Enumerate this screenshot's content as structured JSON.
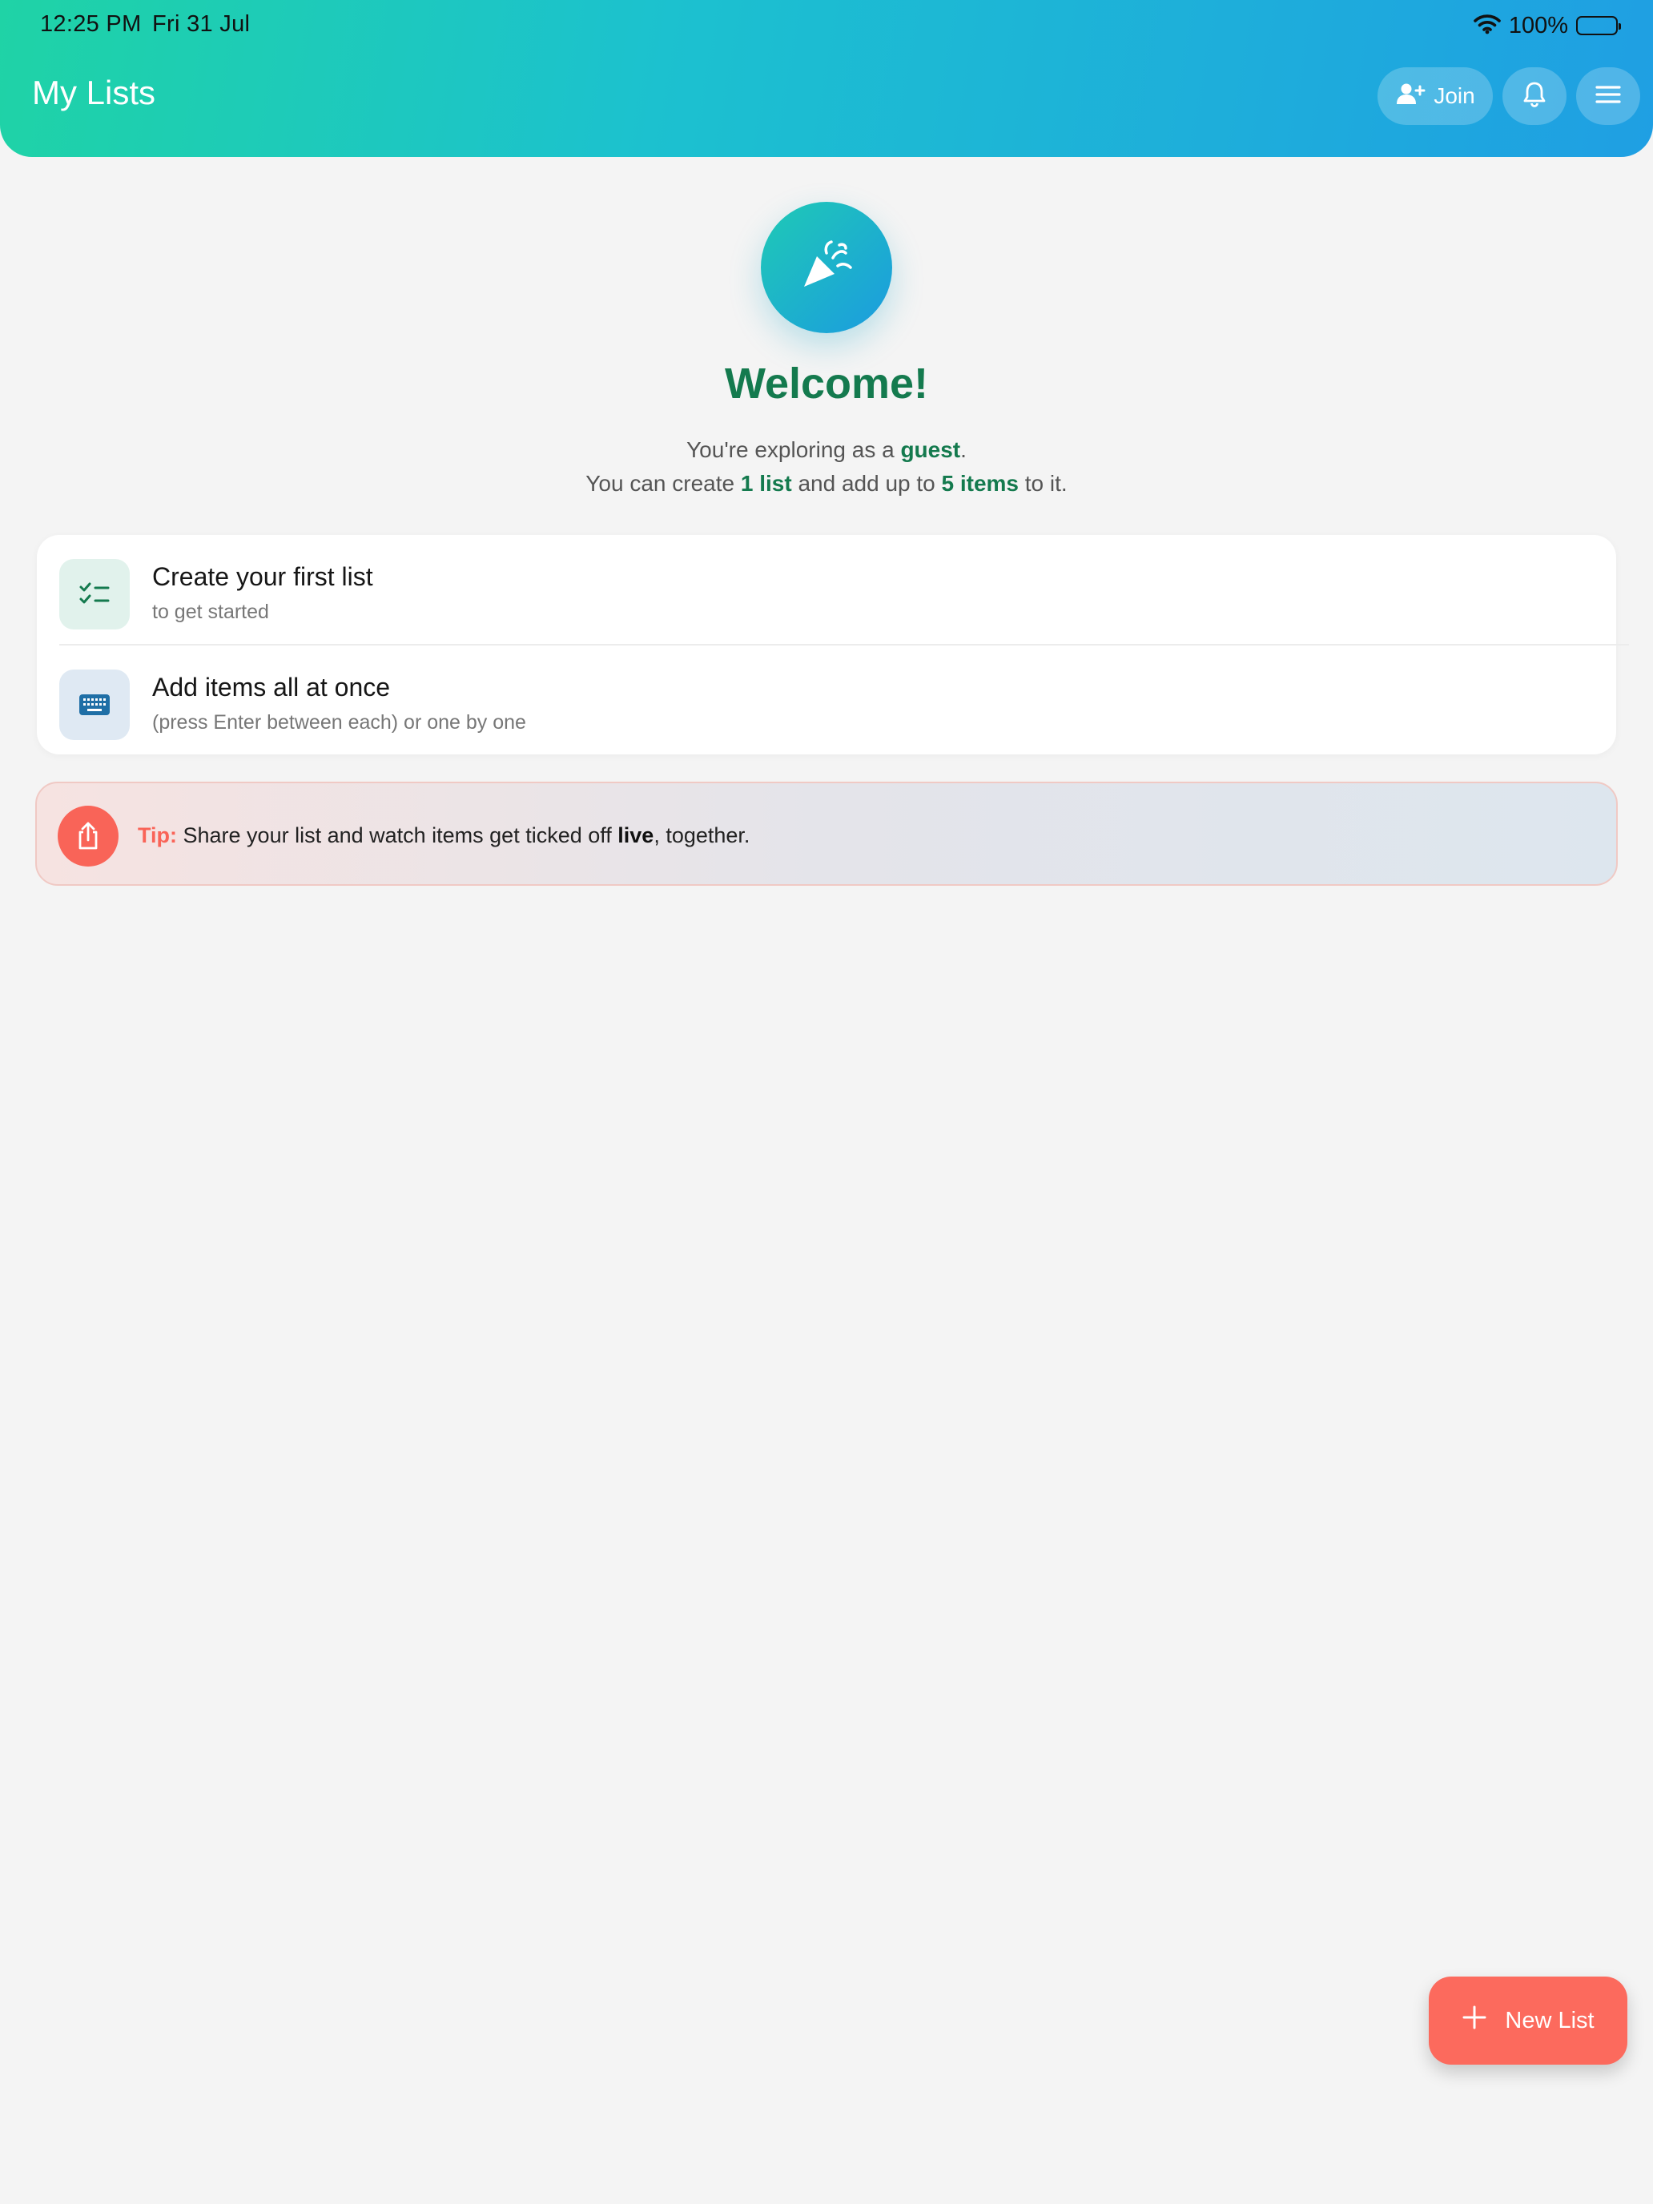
{
  "status_bar": {
    "time": "12:25 PM",
    "date": "Fri 31 Jul",
    "battery": "100%",
    "icons": [
      "wifi-icon",
      "battery-icon"
    ]
  },
  "header": {
    "title": "My Lists",
    "join_label": "Join",
    "buttons": [
      "add-user-icon",
      "bell-icon",
      "menu-icon"
    ]
  },
  "welcome": {
    "title": "Welcome!",
    "line1_prefix": "You're exploring as a ",
    "line1_bold": "guest",
    "line1_suffix": ".",
    "line2_prefix": "You can create ",
    "line2_bold1": "1 list",
    "line2_middle": " and add up to ",
    "line2_bold2": "5 items",
    "line2_suffix": " to it.",
    "icon": "party-popper-icon"
  },
  "features": [
    {
      "title": "Create your first list",
      "subtitle": "to get started",
      "icon": "checklist-icon"
    },
    {
      "title": "Add items all at once",
      "subtitle": "(press Enter between each) or one by one",
      "icon": "keyboard-icon"
    }
  ],
  "tip": {
    "label": "Tip:",
    "text_before": " Share your list and watch items get ticked off ",
    "text_bold": "live",
    "text_after": ", together.",
    "icon": "share-icon"
  },
  "fab": {
    "label": "New List",
    "icon": "plus-icon"
  },
  "colors": {
    "header_gradient_start": "#1fd3a6",
    "header_gradient_end": "#1f9fe3",
    "brand_green": "#147a4e",
    "accent_coral": "#fc6a5d",
    "background": "#f4f4f4"
  }
}
